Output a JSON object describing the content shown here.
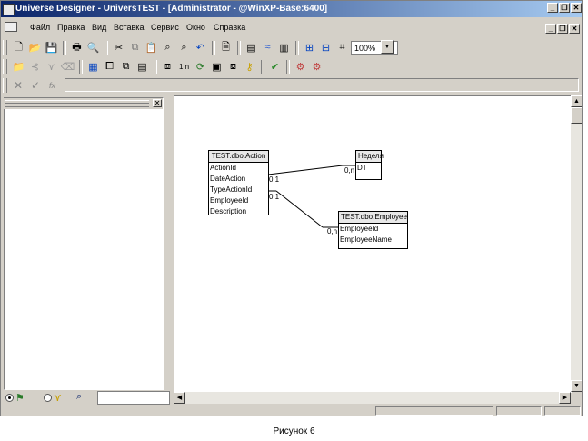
{
  "window": {
    "title": "Universe Designer - UniversTEST - [Administrator - @WinXP-Base:6400]"
  },
  "menu": [
    {
      "label": "Файл"
    },
    {
      "label": "Правка"
    },
    {
      "label": "Вид"
    },
    {
      "label": "Вставка"
    },
    {
      "label": "Сервис"
    },
    {
      "label": "Окно"
    },
    {
      "label": "Справка"
    }
  ],
  "toolbar": {
    "zoom_value": "100%"
  },
  "formula_bar": {
    "fx_label": "fx"
  },
  "schema": {
    "tables": [
      {
        "name": "TEST.dbo.Action",
        "columns": [
          "ActionId",
          "DateAction",
          "TypeActionId",
          "EmployeeId",
          "Description"
        ]
      },
      {
        "name": "Неделя",
        "columns": [
          "DT"
        ]
      },
      {
        "name": "TEST.dbo.Employee",
        "columns": [
          "EmployeeId",
          "EmployeeName"
        ]
      }
    ],
    "joins": [
      {
        "from": "TEST.dbo.Action",
        "to": "Неделя",
        "from_card": "0,1",
        "to_card": "0,n"
      },
      {
        "from": "TEST.dbo.Action",
        "to": "TEST.dbo.Employee",
        "from_card": "0,1",
        "to_card": "0,n"
      }
    ]
  },
  "caption": "Рисунок 6"
}
